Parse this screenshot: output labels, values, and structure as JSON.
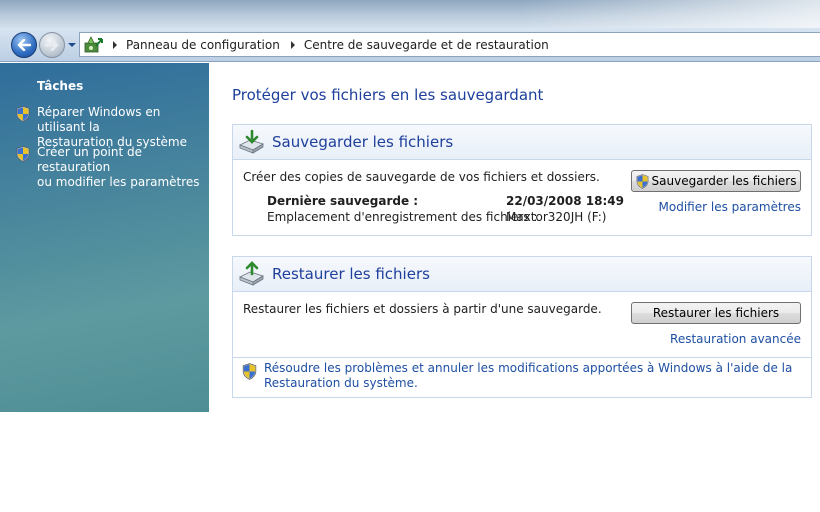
{
  "breadcrumb": {
    "items": [
      "Panneau de configuration",
      "Centre de sauvegarde et de restauration"
    ]
  },
  "task_pane": {
    "title": "Tâches",
    "tasks": [
      {
        "line1": "Réparer Windows en utilisant la",
        "line2": "Restauration du système",
        "icon": "shield-icon"
      },
      {
        "line1": "Créer un point de restauration",
        "line2": "ou modifier les paramètres",
        "icon": "shield-icon"
      }
    ]
  },
  "main": {
    "heading": "Protéger vos fichiers en les sauvegardant",
    "backup": {
      "title": "Sauvegarder les fichiers",
      "description": "Créer des copies de sauvegarde de vos fichiers et dossiers.",
      "last_backup_label": "Dernière sauvegarde :",
      "last_backup_value": "22/03/2008 18:49",
      "location_label": "Emplacement d'enregistrement des fichiers :",
      "location_value": "Maxtor320JH (F:)",
      "button_label": "Sauvegarder les fichiers",
      "settings_link": "Modifier les paramètres"
    },
    "restore": {
      "title": "Restaurer les fichiers",
      "description": "Restaurer les fichiers et dossiers à partir d'une sauvegarde.",
      "button_label": "Restaurer les fichiers",
      "advanced_link": "Restauration avancée"
    },
    "help_link": "Résoudre les problèmes et annuler les modifications apportées à Windows à l'aide de la Restauration du système."
  },
  "colors": {
    "accent_text": "#1e3f9c",
    "link": "#1e4fa3",
    "task_pane_top": "#2f6d9c",
    "task_pane_bottom": "#5d9aa0"
  }
}
